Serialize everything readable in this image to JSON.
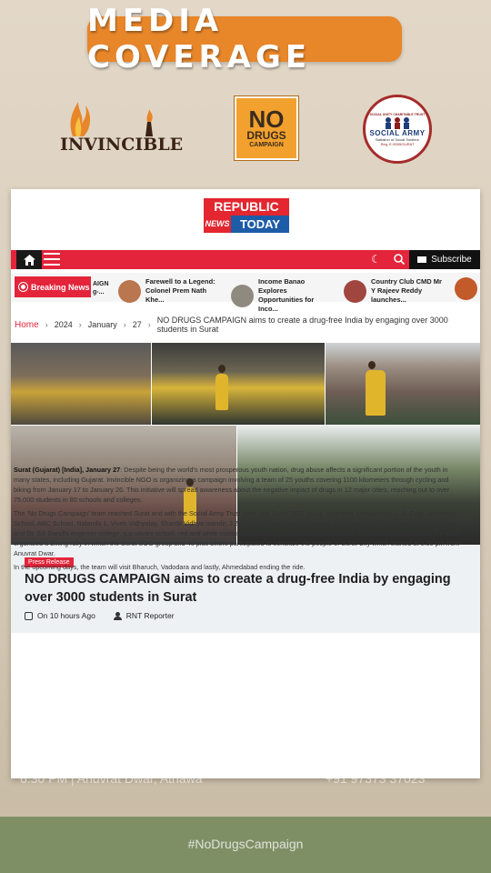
{
  "banner": {
    "title": "MEDIA COVERAGE"
  },
  "logos": {
    "invincible": "INVINCIBLE",
    "no_drugs": {
      "line1": "NO",
      "line2": "DRUGS",
      "line3": "CAMPAIGN"
    },
    "social_army": {
      "top": "SOCIAL UNITY CHARITABLE TRUST",
      "name": "SOCIAL ARMY",
      "sub": "Battalion of Social Soldiers",
      "reg": "Reg. E-9555/SURAT"
    }
  },
  "site": {
    "logo_top": "REPUBLIC",
    "logo_news": "NEWS",
    "logo_today": "TODAY",
    "subscribe": "Subscribe"
  },
  "ticker": {
    "label": "Breaking News",
    "fragment": "AIGN\ng-...",
    "items": [
      {
        "text": "Farewell to a Legend: Colonel Prem Nath Khe...",
        "thumb_color": "#b9764f"
      },
      {
        "text": "Income Banao Explores Opportunities for Inco...",
        "thumb_color": "#8f8a80"
      },
      {
        "text": "Country Club CMD Mr Y Rajeev Reddy launches...",
        "thumb_color": "#a0463e"
      }
    ]
  },
  "breadcrumb": {
    "home": "Home",
    "year": "2024",
    "month": "January",
    "day": "27",
    "current": "NO DRUGS CAMPAIGN aims to create a drug-free India by engaging over 3000 students in Surat"
  },
  "article": {
    "tag": "Press Release",
    "headline": "NO DRUGS CAMPAIGN aims to create a drug-free India by engaging over 3000 students in Surat",
    "date": "On 10 hours Ago",
    "author": "RNT Reporter",
    "lead": "Surat (Gujarat) [India], January 27",
    "p1": ": Despite being the world's most prosperous youth nation, drug abuse affects a significant portion of the youth in many states, including Gujarat. Invincible NGO is organizing a campaign involving a team of 25 youths covering 1100 kilometers through cycling and biking from January 17 to January 26. This initiative will spread awareness about the negative impact of drugs in 12 major cities, reaching out to over 75,000 students in 80 schools and colleges.",
    "p2": "The 'No Drugs Campaign' team reached Surat and with the Social Army Trust team and Surat SOG group organised seminars on J. B. Carp, Ashadeep School, ABC School, Nalanda 1, Vivek Vidhyalay, Sharda Vidhya mandir, J.Z. Shah college, Navyug college, Tapi college, K. P. College, Tapovan school and Dr. SS Gandhi engineer college, p.p.savani school, red and white institute on January 23-24 involving more than 3000 students. Moreover, the team organized a Biking rally in which the Surat SOG group and 40 plus bikers participated to sensitize the people of Surat City which started at 6:30 pm from Anuvrat Dwar.",
    "p3": "In the upcoming days, the team will visit Bharuch, Vadodara and lastly, Ahmedabad ending the ride."
  },
  "footer": {
    "ghost_left": "6:30 PM | Anuvrat Dwar, Athawa",
    "ghost_right": "+91 97373 37023",
    "hashtag": "#NoDrugsCampaign"
  }
}
